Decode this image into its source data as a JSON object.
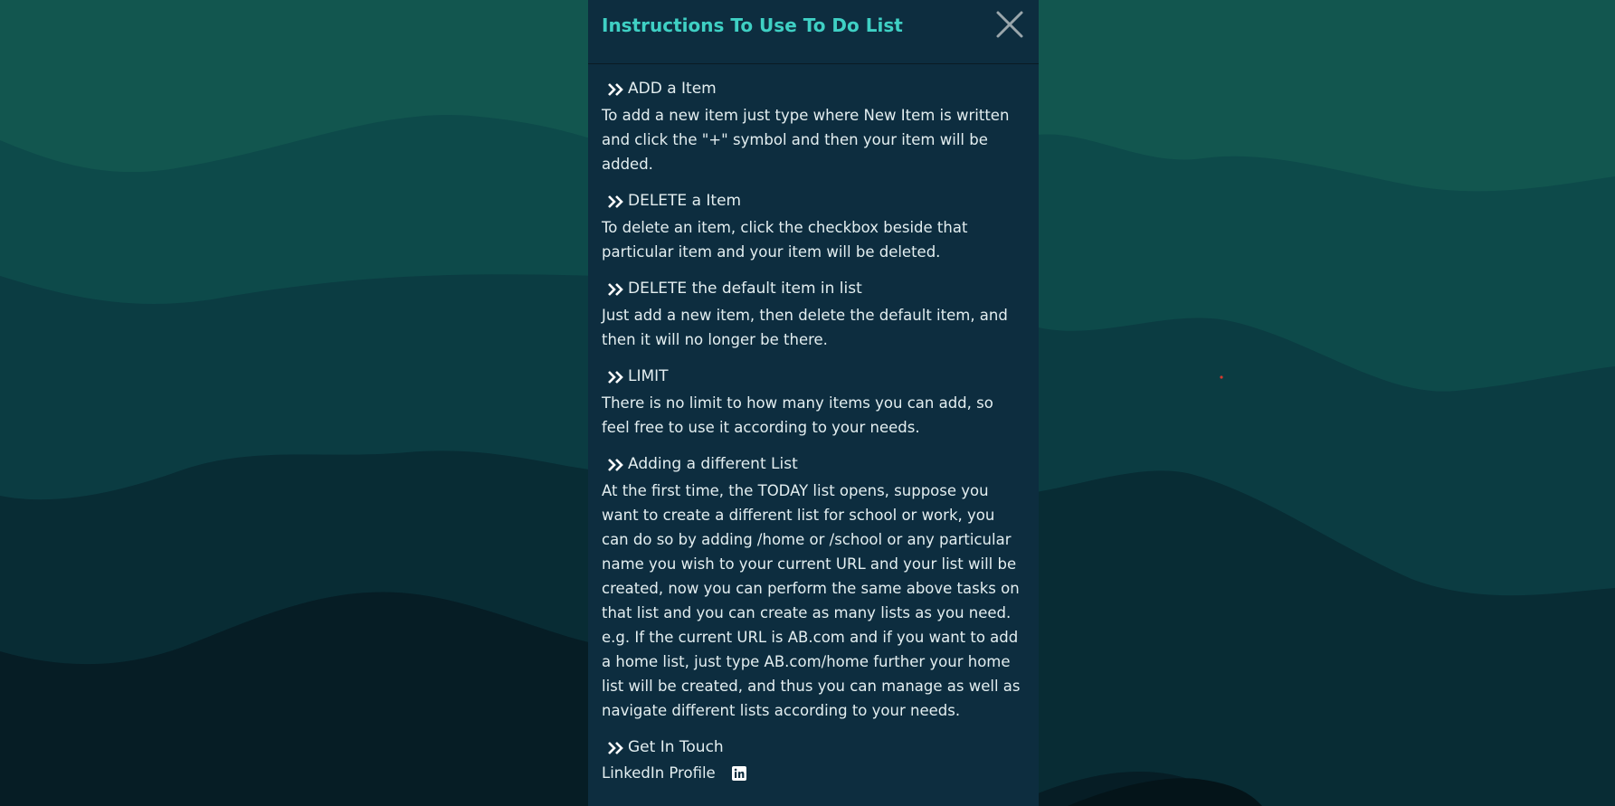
{
  "modal": {
    "title": "Instructions To Use To Do List",
    "close_icon": "close-icon"
  },
  "sections": [
    {
      "heading": "ADD a Item",
      "paragraphs": [
        "To add a new item just type where New Item is written and click the \"+\" symbol and then your item will be added."
      ]
    },
    {
      "heading": "DELETE a Item",
      "paragraphs": [
        "To delete an item, click the checkbox beside that particular item and your item will be deleted."
      ]
    },
    {
      "heading": "DELETE the default item in list",
      "paragraphs": [
        "Just add a new item, then delete the default item, and then it will no longer be there."
      ]
    },
    {
      "heading": "LIMIT",
      "paragraphs": [
        "There is no limit to how many items you can add, so feel free to use it according to your needs."
      ]
    },
    {
      "heading": "Adding a different List",
      "paragraphs": [
        "At the first time, the TODAY list opens, suppose you want to create a different list for school or work, you can do so by adding /home or /school or any particular name you wish to your current URL and your list will be created, now you can perform the same above tasks on that list and you can create as many lists as you need.",
        "e.g. If the current URL is AB.com and if you want to add a home list, just type AB.com/home further your home list will be created, and thus you can manage as well as navigate different lists according to your needs."
      ]
    }
  ],
  "contact": {
    "heading": "Get In Touch",
    "linkedin_label": "LinkedIn Profile",
    "linkedin_icon": "linkedin-icon"
  },
  "colors": {
    "accent": "#3fd0c4",
    "panel_bg": "#0d2d3f",
    "text": "#e3eef0"
  }
}
